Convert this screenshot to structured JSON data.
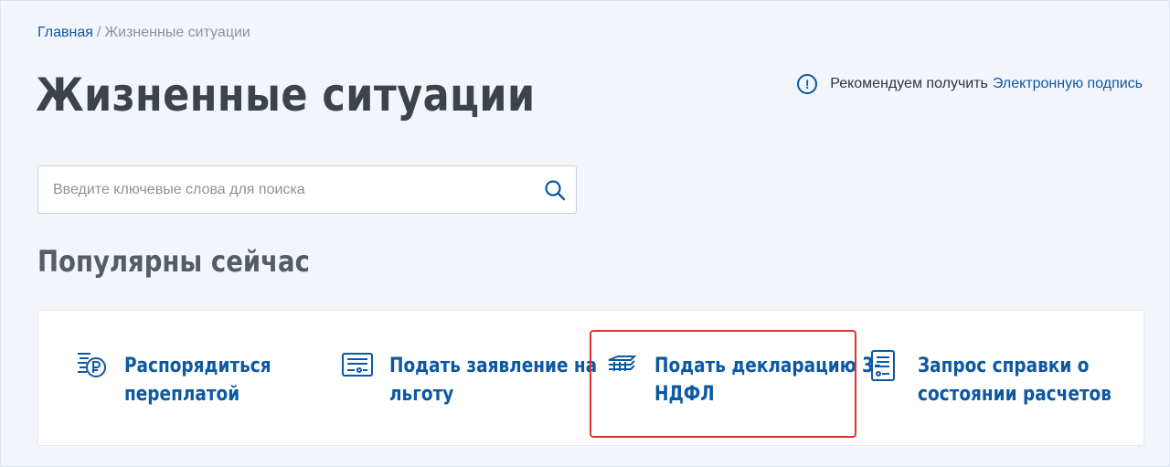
{
  "breadcrumb": {
    "home": "Главная",
    "separator": "/",
    "current": "Жизненные ситуации"
  },
  "page": {
    "title": "Жизненные ситуации"
  },
  "recommend": {
    "icon": "info-icon",
    "text": "Рекомендуем получить",
    "link": "Электронную подпись"
  },
  "search": {
    "placeholder": "Введите ключевые слова для поиска",
    "value": "",
    "icon": "search-icon"
  },
  "popular": {
    "title": "Популярны сейчас",
    "items": [
      {
        "line1": "Распорядиться",
        "line2": "переплатой",
        "icon": "ruble-coins-icon"
      },
      {
        "line1": "Подать заявление на",
        "line2": "льготу",
        "icon": "application-form-icon"
      },
      {
        "line1": "Подать декларацию 3-",
        "line2": "НДФЛ",
        "icon": "declaration-icon"
      },
      {
        "line1": "Запрос справки о",
        "line2": "состоянии расчетов",
        "icon": "document-list-icon"
      }
    ]
  },
  "colors": {
    "accent": "#0b58a5",
    "highlight": "#e0322b",
    "background": "#f2f6fa",
    "title": "#3d434b"
  }
}
